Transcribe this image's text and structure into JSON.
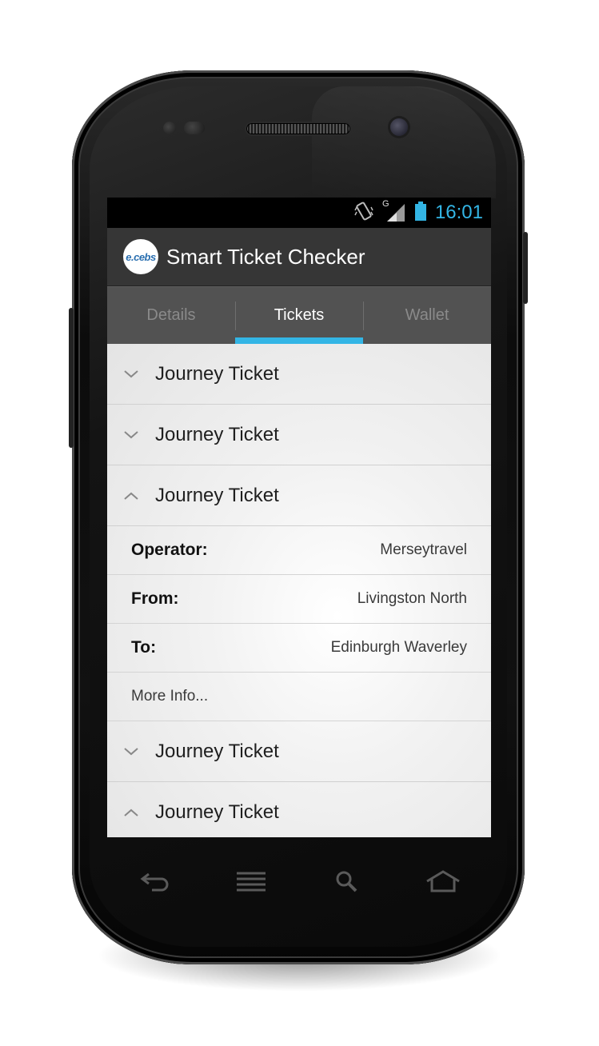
{
  "status_bar": {
    "time": "16:01",
    "icons": [
      "vibrate-icon",
      "signal-icon",
      "battery-icon"
    ],
    "network_letter": "G"
  },
  "action_bar": {
    "logo_text": "e.cebs",
    "title": "Smart Ticket Checker"
  },
  "tabs": [
    {
      "label": "Details",
      "active": false
    },
    {
      "label": "Tickets",
      "active": true
    },
    {
      "label": "Wallet",
      "active": false
    }
  ],
  "tickets": [
    {
      "label": "Journey Ticket",
      "expanded": false
    },
    {
      "label": "Journey Ticket",
      "expanded": false
    },
    {
      "label": "Journey Ticket",
      "expanded": true,
      "details": [
        {
          "label": "Operator:",
          "value": "Merseytravel"
        },
        {
          "label": "From:",
          "value": "Livingston North"
        },
        {
          "label": "To:",
          "value": "Edinburgh Waverley"
        }
      ],
      "more_link": "More Info..."
    },
    {
      "label": "Journey Ticket",
      "expanded": false
    },
    {
      "label": "Journey Ticket",
      "expanded": true
    }
  ],
  "nav_bar": [
    "back-icon",
    "menu-icon",
    "search-icon",
    "home-icon"
  ],
  "colors": {
    "accent": "#33b5e5",
    "action_bar": "#363636",
    "tab_bar": "#525252"
  }
}
